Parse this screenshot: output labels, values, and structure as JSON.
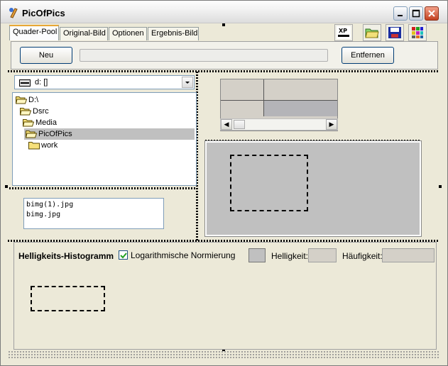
{
  "window": {
    "title": "PicOfPics"
  },
  "tabs": [
    {
      "label": "Quader-Pool",
      "active": true
    },
    {
      "label": "Original-Bild",
      "active": false
    },
    {
      "label": "Optionen",
      "active": false
    },
    {
      "label": "Ergebnis-Bild",
      "active": false
    }
  ],
  "toolbar": {
    "xp_icon_text": "XP",
    "icons": [
      "xp-style-icon",
      "open-folder-icon",
      "save-disk-icon",
      "color-grid-icon"
    ]
  },
  "actions": {
    "new_label": "Neu",
    "remove_label": "Entfernen"
  },
  "drive": {
    "value": "d: []"
  },
  "tree": [
    {
      "label": "D:\\"
    },
    {
      "label": "Dsrc"
    },
    {
      "label": "Media"
    },
    {
      "label": "PicOfPics",
      "selected": true
    },
    {
      "label": "work"
    }
  ],
  "files": [
    "bimg(1).jpg",
    "bimg.jpg"
  ],
  "histogram": {
    "title": "Helligkeits-Histogramm",
    "log_norm_label": "Logarithmische Normierung",
    "log_norm_checked": true,
    "brightness_label": "Helligkeit:",
    "frequency_label": "Häufigkeit:",
    "brightness_value": "",
    "frequency_value": ""
  },
  "colors": {
    "selection": "#c0c0c0",
    "window_bg": "#ece9d8"
  }
}
